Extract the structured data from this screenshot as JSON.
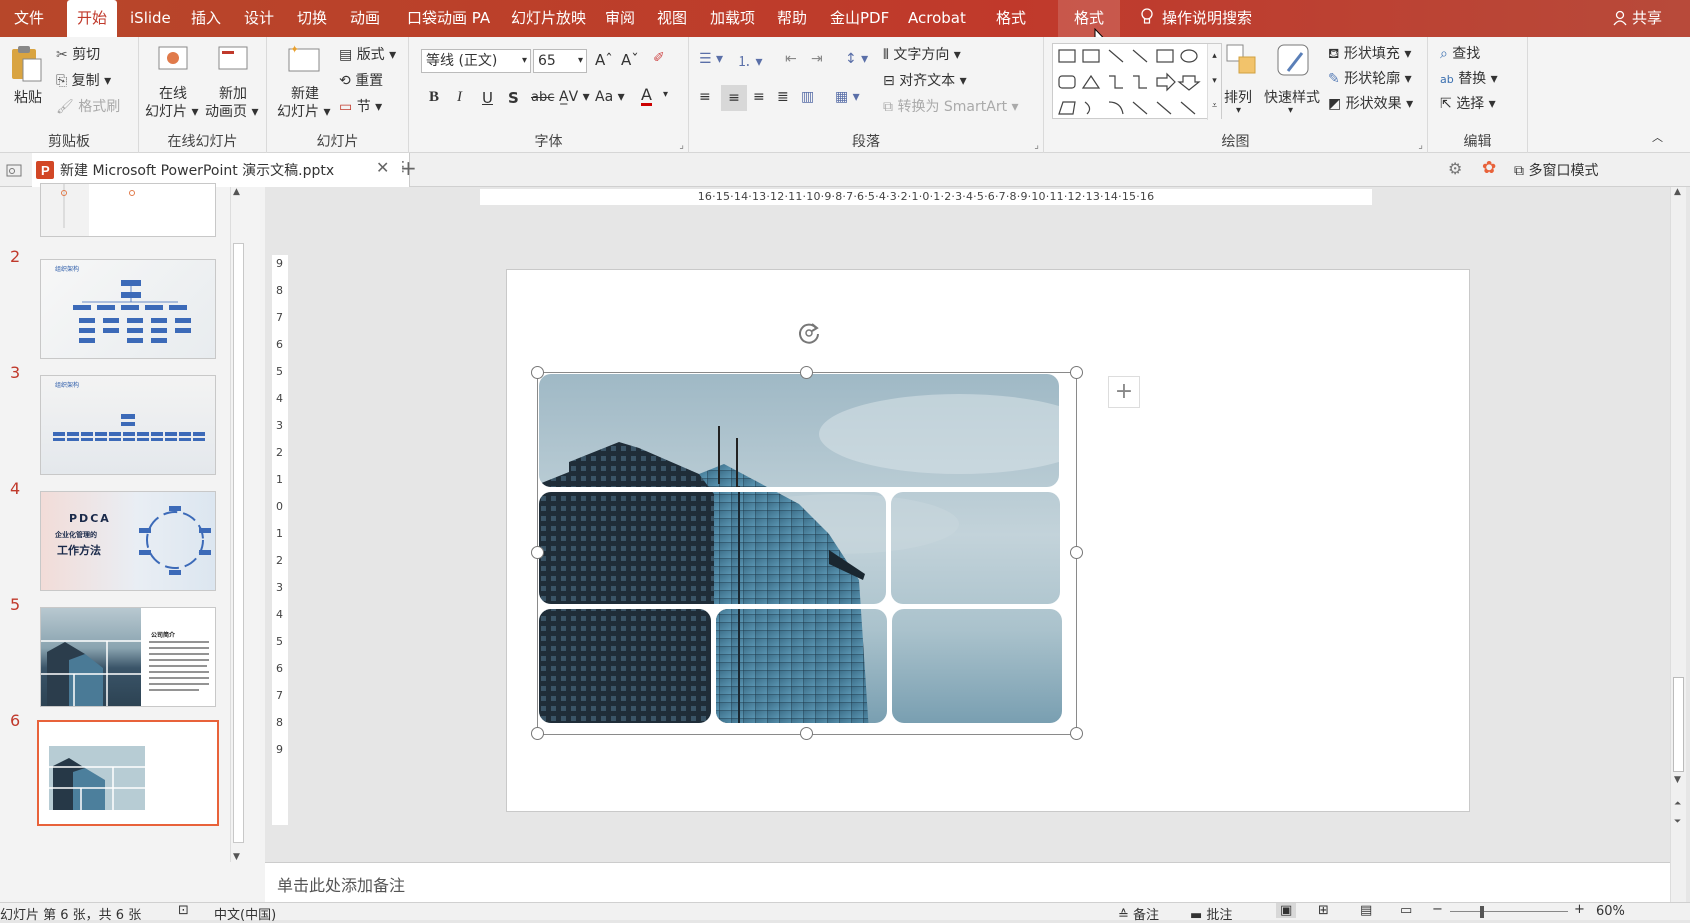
{
  "menu": {
    "items": [
      "文件",
      "开始",
      "iSlide",
      "插入",
      "设计",
      "切换",
      "动画",
      "口袋动画 PA",
      "幻灯片放映",
      "审阅",
      "视图",
      "加载项",
      "帮助",
      "金山PDF",
      "Acrobat",
      "格式",
      "格式"
    ],
    "search": "操作说明搜索",
    "share": "共享"
  },
  "ribbon": {
    "clipboard": {
      "paste": "粘贴",
      "cut": "剪切",
      "copy": "复制",
      "format_painter": "格式刷",
      "label": "剪贴板"
    },
    "online": {
      "online_slide": "在线",
      "online_slide2": "幻灯片",
      "new_anim": "新加",
      "new_anim2": "动画页",
      "label": "在线幻灯片"
    },
    "slides": {
      "new_slide": "新建",
      "new_slide2": "幻灯片",
      "layout": "版式",
      "reset": "重置",
      "section": "节",
      "label": "幻灯片"
    },
    "font": {
      "name": "等线 (正文)",
      "size": "65",
      "label": "字体",
      "case": "Aa"
    },
    "paragraph": {
      "text_direction": "文字方向",
      "align_text": "对齐文本",
      "smartart": "转换为 SmartArt",
      "label": "段落"
    },
    "drawing": {
      "arrange": "排列",
      "quick_styles": "快速样式",
      "fill": "形状填充",
      "outline": "形状轮廓",
      "effects": "形状效果",
      "label": "绘图"
    },
    "editing": {
      "find": "查找",
      "replace": "替换",
      "select": "选择",
      "label": "编辑"
    }
  },
  "tabbar": {
    "doc_title": "新建 Microsoft PowerPoint 演示文稿.pptx",
    "multiwindow": "多窗口模式"
  },
  "thumbnails": [
    {
      "num": "2",
      "title": "组织架构"
    },
    {
      "num": "3",
      "title": "组织架构"
    },
    {
      "num": "4",
      "title": "PDCA",
      "subtitle": "企业化管理的",
      "subtitle2": "工作方法"
    },
    {
      "num": "5",
      "title": "公司简介"
    },
    {
      "num": "6"
    }
  ],
  "ruler": {
    "h": "16·15·14·13·12·11·10·9·8·7·6·5·4·3·2·1·0·1·2·3·4·5·6·7·8·9·10·11·12·13·14·15·16"
  },
  "notes": {
    "placeholder": "单击此处添加备注"
  },
  "status": {
    "slide_info": "幻灯片 第 6 张，共 6 张",
    "lang": "中文(中国)",
    "notes": "备注",
    "comments": "批注",
    "zoom": "60%"
  },
  "colors": {
    "accent": "#c0392b",
    "ribbon_bg": "#f4f4f4",
    "selected_thumb": "#e8623a"
  }
}
